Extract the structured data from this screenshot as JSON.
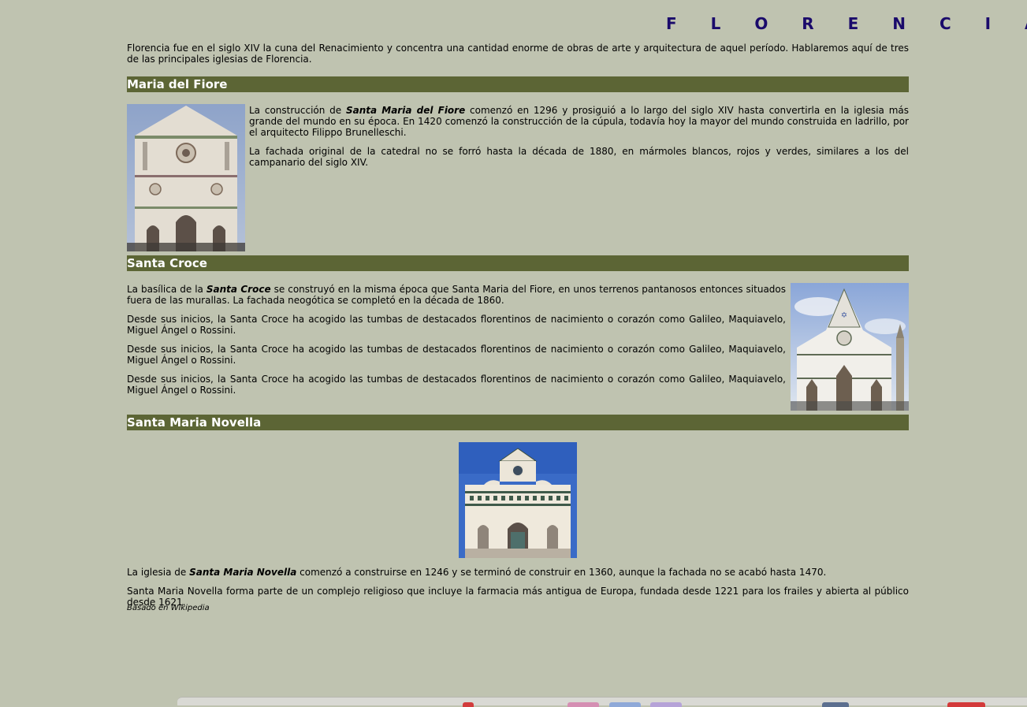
{
  "title": "F L O R E N C I A",
  "intro": "Florencia fue en el siglo XIV la cuna del Renacimiento y concentra una cantidad enorme de obras de arte y arquitectura de aquel período. Hablaremos aquí de tres de las principales iglesias de Florencia.",
  "sections": [
    {
      "heading": "Maria del Fiore",
      "p1_before": "La construcción de ",
      "p1_em": "Santa Maria del Fiore",
      "p1_after": " comenzó en 1296 y prosiguió a lo largo del siglo XIV hasta convertirla en la iglesia más grande del mundo en su época. En 1420 comenzó la construcción de la cúpula, todavía hoy la mayor del mundo construida en ladrillo, por el arquitecto Filippo Brunelleschi.",
      "p2": "La fachada original de la catedral no se forró hasta la década de 1880, en mármoles blancos, rojos y verdes, similares a los del campanario del siglo XIV."
    },
    {
      "heading": "Santa Croce",
      "p1_before": "La basílica de la ",
      "p1_em": "Santa Croce",
      "p1_after": " se construyó en la misma época que Santa Maria del Fiore, en unos terrenos pantanosos entonces situados fuera de las murallas. La fachada neogótica se completó en la década de 1860.",
      "p2": "Desde sus inicios, la Santa Croce ha acogido las tumbas de destacados florentinos de nacimiento o corazón como Galileo, Maquiavelo, Miguel Ángel o Rossini.",
      "p3": "Desde sus inicios, la Santa Croce ha acogido las tumbas de destacados florentinos de nacimiento o corazón como Galileo, Maquiavelo, Miguel Ángel o Rossini.",
      "p4": "Desde sus inicios, la Santa Croce ha acogido las tumbas de destacados florentinos de nacimiento o corazón como Galileo, Maquiavelo, Miguel Ángel o Rossini."
    },
    {
      "heading": "Santa Maria Novella",
      "p1_before": "La iglesia de ",
      "p1_em": "Santa Maria Novella",
      "p1_after": " comenzó a construirse en 1246 y se terminó de construir en 1360, aunque la fachada no se acabó hasta 1470.",
      "p2": "Santa Maria Novella forma parte de un complejo religioso que incluye la farmacia más antigua de Europa, fundada desde 1221 para los frailes y abierta al público desde 1621."
    }
  ],
  "credit": "Basado en Wikipedia",
  "colors": {
    "background": "#bfc3b0",
    "section_bar": "#5c6535",
    "title": "#1a0a6b"
  }
}
